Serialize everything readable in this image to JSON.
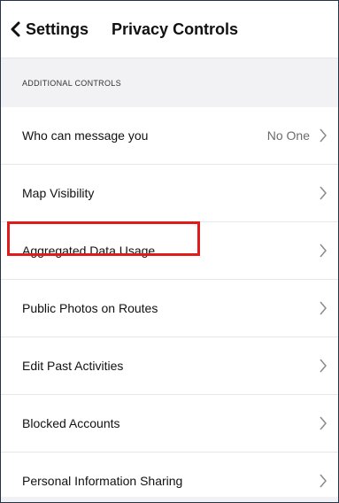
{
  "header": {
    "back_label": "Settings",
    "title": "Privacy Controls"
  },
  "section": {
    "title": "ADDITIONAL CONTROLS"
  },
  "rows": [
    {
      "label": "Who can message you",
      "value": "No One"
    },
    {
      "label": "Map Visibility",
      "value": ""
    },
    {
      "label": "Aggregated Data Usage",
      "value": ""
    },
    {
      "label": "Public Photos on Routes",
      "value": ""
    },
    {
      "label": "Edit Past Activities",
      "value": ""
    },
    {
      "label": "Blocked Accounts",
      "value": ""
    },
    {
      "label": "Personal Information Sharing",
      "value": ""
    }
  ],
  "icons": {
    "back": "chevron-left-icon",
    "row": "chevron-right-icon"
  },
  "colors": {
    "highlight": "#e11a1a",
    "section_bg": "#f2f2f4",
    "border": "#243447"
  }
}
